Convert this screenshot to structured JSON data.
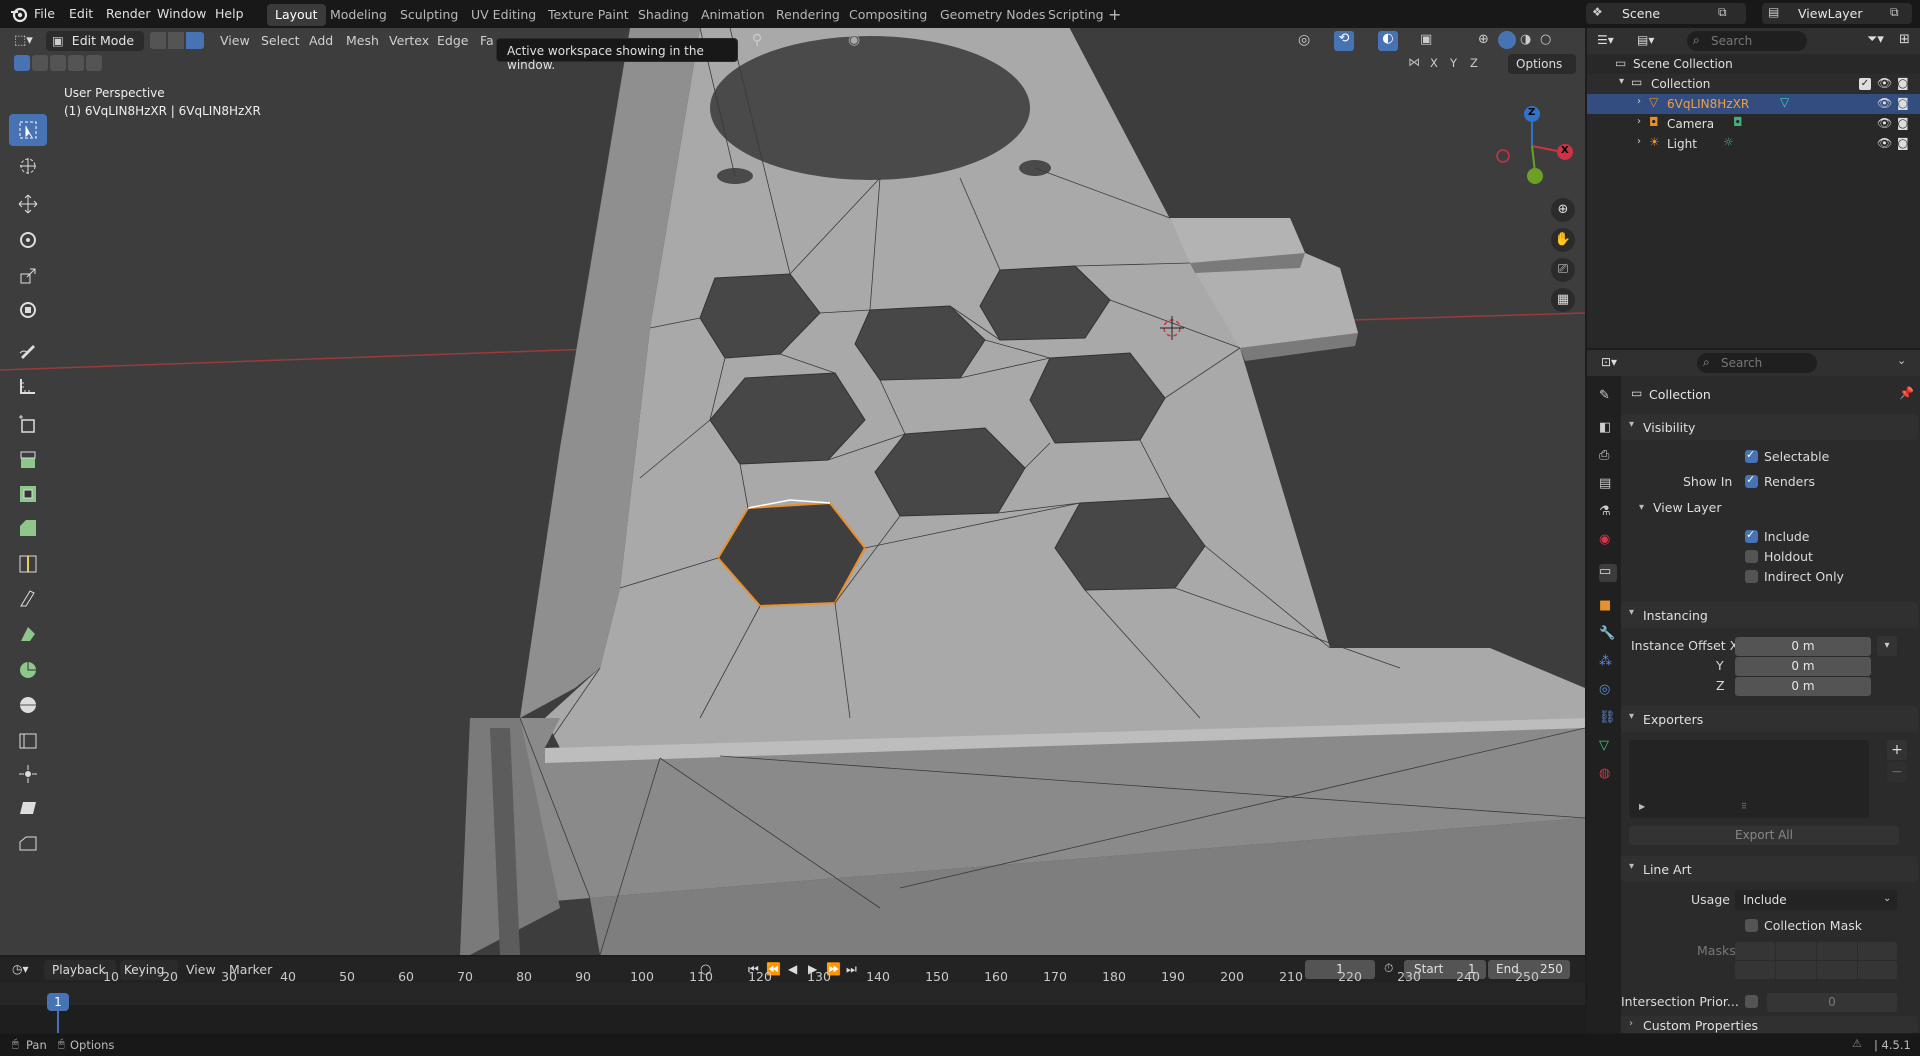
{
  "menus": [
    "File",
    "Edit",
    "Render",
    "Window",
    "Help"
  ],
  "workspaces": [
    "Layout",
    "Modeling",
    "Sculpting",
    "UV Editing",
    "Texture Paint",
    "Shading",
    "Animation",
    "Rendering",
    "Compositing",
    "Geometry Nodes",
    "Scripting"
  ],
  "active_workspace": "Layout",
  "scene": "Scene",
  "view_layer": "ViewLayer",
  "viewport": {
    "mode": "Edit Mode",
    "header_menus": [
      "View",
      "Select",
      "Add",
      "Mesh",
      "Vertex",
      "Edge",
      "Fa"
    ],
    "tooltip": "Active workspace showing in the window.",
    "perspective": "User Perspective",
    "object_info": "(1) 6VqLIN8HzXR | 6VqLIN8HzXR",
    "options": "Options",
    "axes": [
      "X",
      "Y",
      "Z"
    ],
    "gizmo": {
      "z": "Z",
      "x": "X"
    }
  },
  "outliner": {
    "search_placeholder": "Search",
    "scene_collection": "Scene Collection",
    "collection": "Collection",
    "items": [
      "6VqLIN8HzXR",
      "Camera",
      "Light"
    ]
  },
  "properties": {
    "search_placeholder": "Search",
    "title": "Collection",
    "visibility": "Visibility",
    "selectable": "Selectable",
    "show_in": "Show In",
    "renders": "Renders",
    "view_layer": "View Layer",
    "include": "Include",
    "holdout": "Holdout",
    "indirect_only": "Indirect Only",
    "instancing": "Instancing",
    "instance_offset_x": "Instance Offset X",
    "y": "Y",
    "z": "Z",
    "offset_values": [
      "0 m",
      "0 m",
      "0 m"
    ],
    "exporters": "Exporters",
    "export_all": "Export All",
    "line_art": "Line Art",
    "usage": "Usage",
    "usage_value": "Include",
    "collection_mask": "Collection Mask",
    "masks": "Masks",
    "intersection_priority": "Intersection Prior...",
    "intersection_value": "0",
    "custom_properties": "Custom Properties"
  },
  "timeline": {
    "menus": [
      "Playback",
      "Keying",
      "View",
      "Marker"
    ],
    "current_frame": "1",
    "start_label": "Start",
    "start": "1",
    "end_label": "End",
    "end": "250",
    "ticks": [
      "1",
      "10",
      "20",
      "30",
      "40",
      "50",
      "60",
      "70",
      "80",
      "90",
      "100",
      "110",
      "120",
      "130",
      "140",
      "150",
      "160",
      "170",
      "180",
      "190",
      "200",
      "210",
      "220",
      "230",
      "240",
      "250"
    ]
  },
  "status": {
    "pan": "Pan",
    "options": "Options",
    "version": "4.5.1"
  },
  "colors": {
    "selection": "#4772b3",
    "edge_select": "#e8902c",
    "x_axis": "#cc3344",
    "y_axis": "#6ca025",
    "z_axis": "#2f73cc"
  }
}
